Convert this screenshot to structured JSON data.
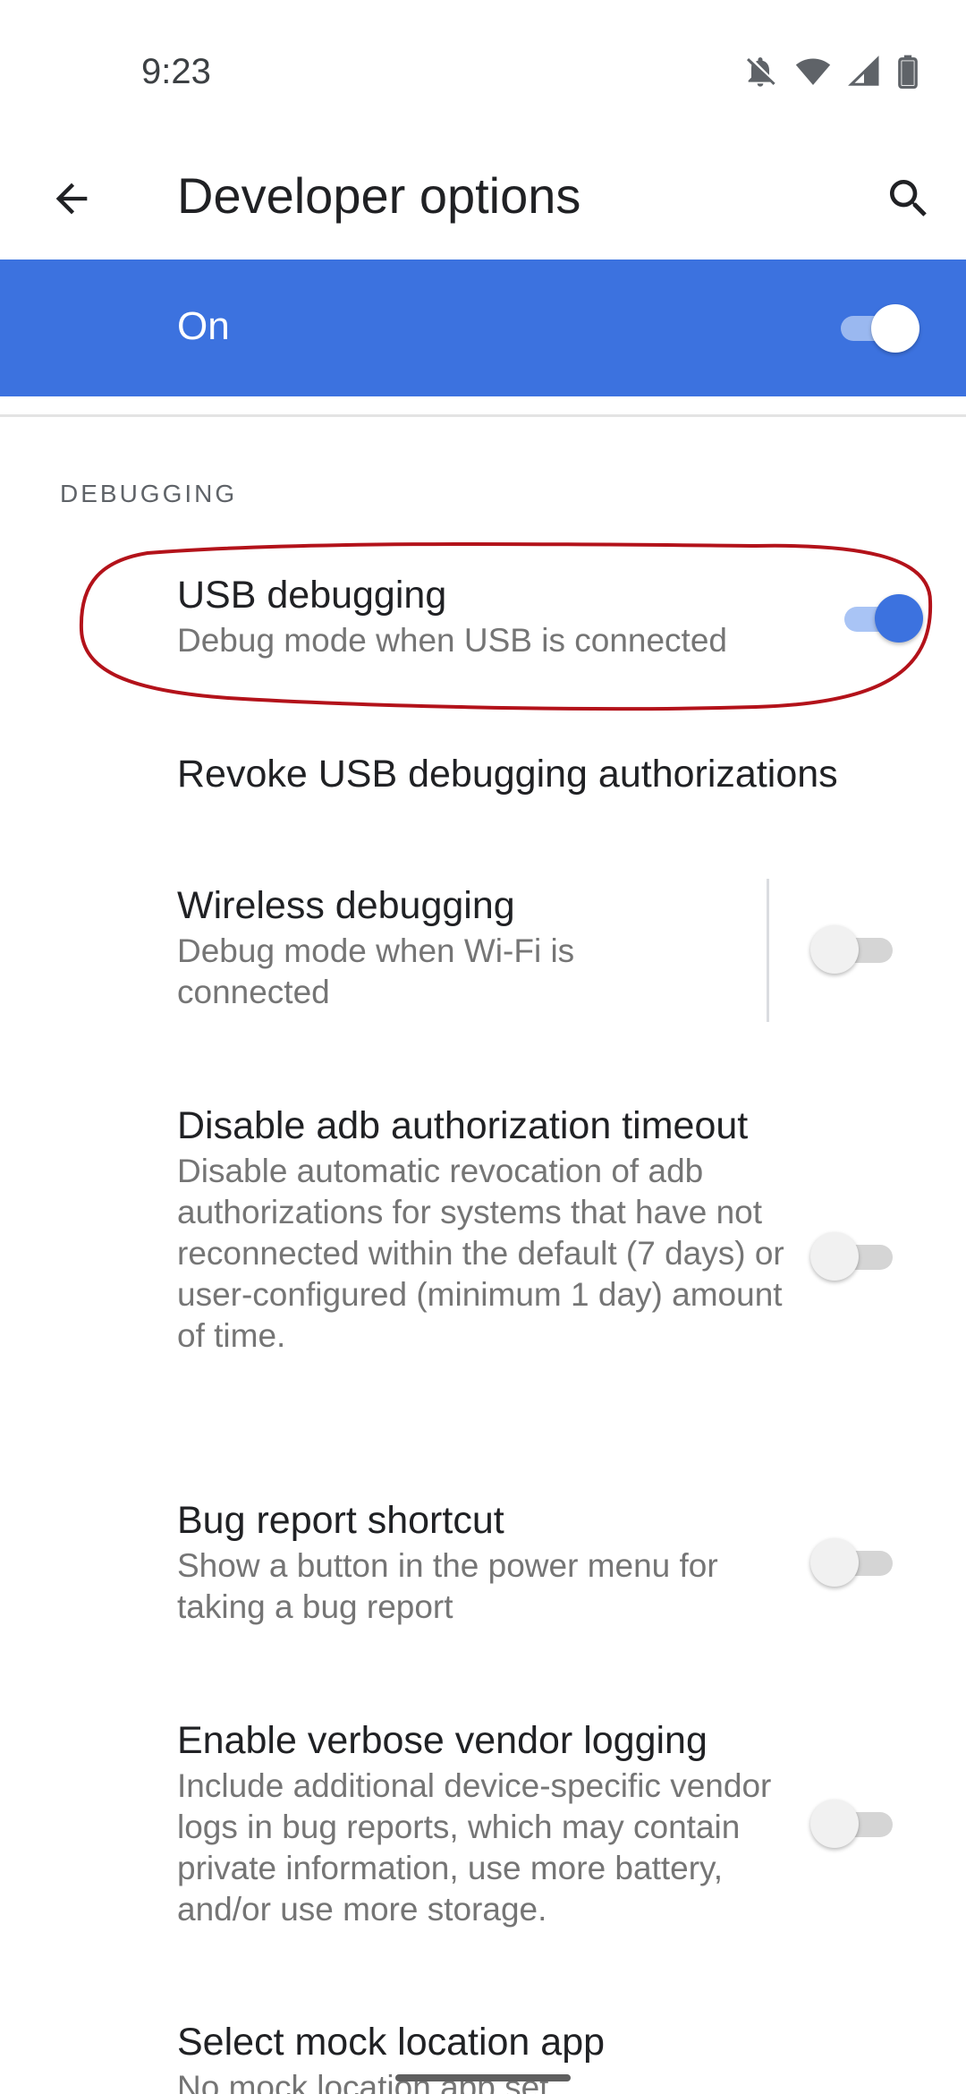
{
  "status_bar": {
    "time": "9:23",
    "icons": [
      "notifications-off-icon",
      "wifi-icon",
      "cellular-signal-icon",
      "battery-icon"
    ]
  },
  "app_bar": {
    "title": "Developer options",
    "back_icon": "arrow-back-icon",
    "search_icon": "search-icon"
  },
  "master_switch": {
    "label": "On",
    "checked": true,
    "color": "#3c72df"
  },
  "section": {
    "header": "DEBUGGING"
  },
  "items": [
    {
      "title": "USB debugging",
      "summary": "Debug mode when USB is connected",
      "toggle": true,
      "checked": true,
      "highlighted": true
    },
    {
      "title": "Revoke USB debugging authorizations",
      "summary": ""
    },
    {
      "title": "Wireless debugging",
      "summary": "Debug mode when Wi-Fi is connected",
      "toggle": true,
      "checked": false
    },
    {
      "title": "Disable adb authorization timeout",
      "summary": "Disable automatic revocation of adb authorizations for systems that have not reconnected within the default (7 days) or user-configured (minimum 1 day) amount of time.",
      "toggle": true,
      "checked": false
    },
    {
      "title": "Bug report shortcut",
      "summary": "Show a button in the power menu for taking a bug report",
      "toggle": true,
      "checked": false
    },
    {
      "title": "Enable verbose vendor logging",
      "summary": "Include additional device-specific vendor logs in bug reports, which may contain private information, use more battery, and/or use more storage.",
      "toggle": true,
      "checked": false
    },
    {
      "title": "Select mock location app",
      "summary": "No mock location app set"
    }
  ],
  "colors": {
    "accent": "#3c72df",
    "annotation": "#b3121a"
  }
}
